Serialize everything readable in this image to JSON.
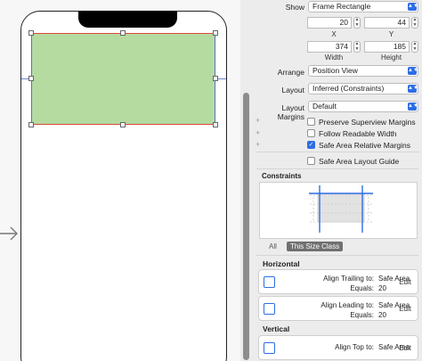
{
  "inspector": {
    "show": {
      "label": "Show",
      "value": "Frame Rectangle"
    },
    "x": {
      "value": "20",
      "label": "X"
    },
    "y": {
      "value": "44",
      "label": "Y"
    },
    "width": {
      "value": "374",
      "label": "Width"
    },
    "height": {
      "value": "185",
      "label": "Height"
    },
    "arrange": {
      "label": "Arrange",
      "value": "Position View"
    },
    "layout": {
      "label": "Layout",
      "value": "Inferred (Constraints)"
    },
    "layout_margins": {
      "label": "Layout Margins",
      "value": "Default"
    },
    "options": [
      {
        "label": "Preserve Superview Margins",
        "checked": false
      },
      {
        "label": "Follow Readable Width",
        "checked": false
      },
      {
        "label": "Safe Area Relative Margins",
        "checked": true
      }
    ],
    "safe_area_guide": {
      "label": "Safe Area Layout Guide",
      "checked": false
    },
    "constraints": {
      "title": "Constraints",
      "size_class_all": "All",
      "size_class_this": "This Size Class"
    },
    "horizontal": {
      "title": "Horizontal",
      "items": [
        {
          "line1": "Align Trailing to:",
          "target": "Safe Area",
          "line2": "Equals:",
          "value": "20",
          "edit": "Edit"
        },
        {
          "line1": "Align Leading to:",
          "target": "Safe Area",
          "line2": "Equals:",
          "value": "20",
          "edit": "Edit"
        }
      ]
    },
    "vertical": {
      "title": "Vertical",
      "items": [
        {
          "line1": "Align Top to:",
          "target": "Safe Area",
          "edit": "Edit"
        }
      ]
    }
  },
  "colors": {
    "accent": "#2d6de5",
    "view_fill": "#b5dba1",
    "constraint_red": "#d94a3a",
    "selection_blue": "#5a6fc4"
  },
  "icons": {
    "scene_entry": "arrow-right-icon",
    "popup": "chevron-updown-icon",
    "constraint": "constraint-align-icon"
  }
}
